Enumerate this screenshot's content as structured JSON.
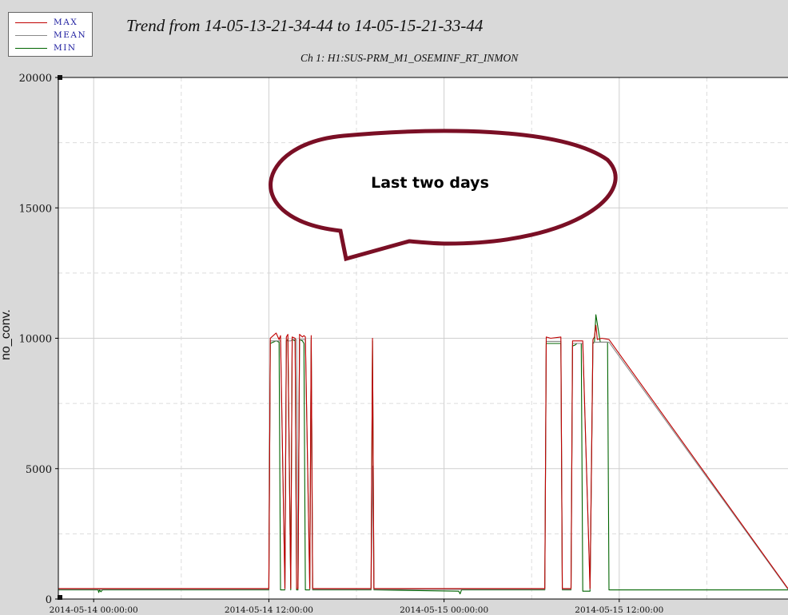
{
  "title": "Trend from 14-05-13-21-34-44 to 14-05-15-21-33-44",
  "subtitle": "Ch 1: H1:SUS-PRM_M1_OSEMINF_RT_INMON",
  "legend": [
    {
      "label": "MAX",
      "color": "#c00000"
    },
    {
      "label": "MEAN",
      "color": "#8a8a8a"
    },
    {
      "label": "MIN",
      "color": "#006400"
    }
  ],
  "annotation": {
    "text": "Last two days",
    "outline_color": "#7a0f25"
  },
  "chart_data": {
    "type": "line",
    "title": "Trend from 14-05-13-21-34-44 to 14-05-15-21-33-44",
    "subtitle": "Ch 1: H1:SUS-PRM_M1_OSEMINF_RT_INMON",
    "xlabel": "",
    "ylabel": "no_conv.",
    "x_unit": "hours",
    "xlim": [
      -2.42,
      47.56
    ],
    "ylim": [
      0,
      20000
    ],
    "yticks": [
      0,
      5000,
      10000,
      15000,
      20000
    ],
    "xticks": [
      {
        "value": 0,
        "label": "2014-05-14 00:00:00"
      },
      {
        "value": 12,
        "label": "2014-05-14 12:00:00"
      },
      {
        "value": 24,
        "label": "2014-05-15 00:00:00"
      },
      {
        "value": 36,
        "label": "2014-05-15 12:00:00"
      }
    ],
    "grid": true,
    "legend_position": "top-left",
    "series": [
      {
        "name": "MIN",
        "color": "#006400",
        "x": [
          -2.42,
          0.3,
          0.35,
          0.4,
          0.5,
          0.6,
          12.0,
          12.1,
          12.5,
          12.7,
          12.8,
          13.1,
          13.2,
          13.3,
          13.5,
          13.6,
          13.8,
          13.9,
          14.0,
          14.1,
          14.3,
          14.4,
          14.5,
          14.8,
          14.9,
          15.0,
          19.0,
          19.1,
          19.2,
          19.3,
          25.0,
          25.1,
          25.2,
          30.9,
          31.0,
          32.0,
          32.1,
          32.7,
          32.8,
          33.0,
          33.1,
          33.2,
          33.4,
          33.5,
          34.0,
          34.2,
          34.3,
          34.4,
          34.7,
          34.8,
          35.2,
          35.3,
          36.0,
          47.56
        ],
        "y": [
          350,
          350,
          250,
          350,
          280,
          350,
          350,
          9800,
          9900,
          9850,
          350,
          350,
          9900,
          9950,
          350,
          9950,
          9900,
          350,
          350,
          9950,
          9900,
          9800,
          350,
          350,
          9950,
          350,
          350,
          9900,
          350,
          350,
          300,
          200,
          350,
          350,
          9800,
          9800,
          350,
          350,
          9700,
          9750,
          9800,
          9800,
          9800,
          300,
          300,
          9800,
          9850,
          10900,
          9850,
          9850,
          9850,
          350,
          350,
          350
        ]
      },
      {
        "name": "MEAN",
        "color": "#8a8a8a",
        "x": [
          -2.42,
          12.0,
          12.1,
          12.8,
          13.1,
          13.2,
          13.5,
          13.6,
          13.9,
          14.0,
          14.1,
          14.5,
          14.8,
          14.9,
          15.0,
          19.0,
          19.1,
          19.2,
          30.9,
          31.0,
          32.0,
          32.1,
          32.7,
          32.8,
          33.5,
          34.0,
          34.2,
          35.3,
          47.56
        ],
        "y": [
          370,
          370,
          9900,
          9900,
          370,
          9900,
          9900,
          9950,
          9950,
          370,
          9950,
          9950,
          370,
          9950,
          370,
          370,
          5100,
          370,
          370,
          9880,
          9880,
          370,
          370,
          9800,
          9800,
          370,
          9850,
          9850,
          370
        ]
      },
      {
        "name": "MAX",
        "color": "#c00000",
        "x": [
          -2.42,
          12.0,
          12.1,
          12.3,
          12.5,
          12.7,
          12.8,
          13.1,
          13.2,
          13.3,
          13.5,
          13.6,
          13.8,
          13.9,
          14.0,
          14.1,
          14.3,
          14.4,
          14.5,
          14.8,
          14.9,
          15.0,
          19.0,
          19.1,
          19.2,
          30.9,
          31.0,
          31.3,
          32.0,
          32.1,
          32.7,
          32.8,
          33.5,
          34.0,
          34.2,
          34.3,
          34.4,
          34.5,
          34.8,
          35.3,
          47.56
        ],
        "y": [
          400,
          400,
          10000,
          10100,
          10200,
          9950,
          10100,
          400,
          10050,
          10150,
          400,
          10050,
          10000,
          400,
          400,
          10150,
          10050,
          10100,
          10050,
          400,
          10100,
          400,
          400,
          10000,
          400,
          400,
          10050,
          10000,
          10050,
          400,
          400,
          9900,
          9900,
          400,
          9950,
          10050,
          10500,
          9950,
          10000,
          9950,
          400
        ]
      }
    ]
  }
}
